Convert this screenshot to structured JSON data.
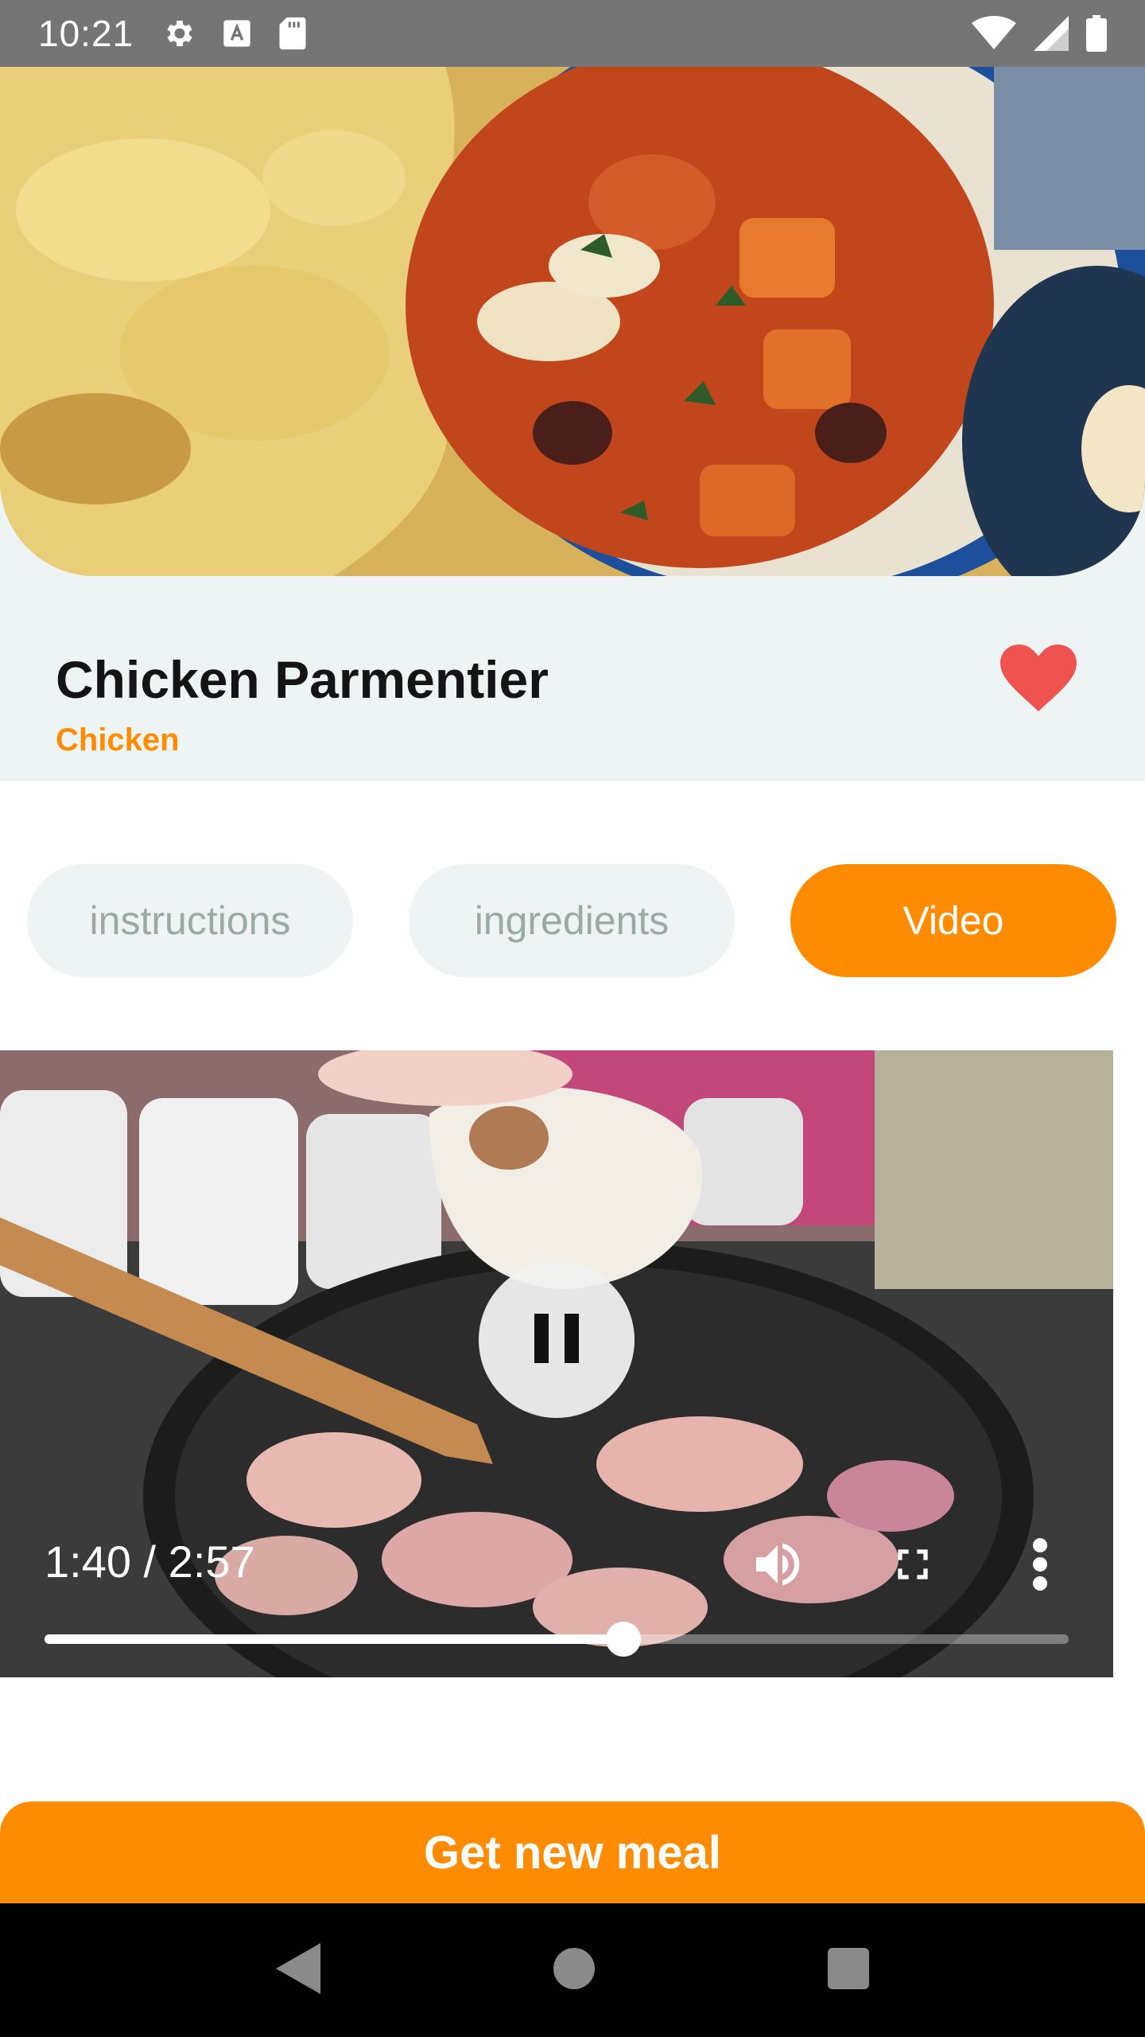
{
  "status_bar": {
    "time": "10:21",
    "icons_left": [
      "settings-icon",
      "text-icon",
      "sd-card-icon"
    ],
    "icons_right": [
      "wifi-icon",
      "signal-icon",
      "battery-icon"
    ]
  },
  "meal": {
    "title": "Chicken Parmentier",
    "category": "Chicken",
    "favorite": true
  },
  "tabs": [
    {
      "label": "instructions",
      "active": false
    },
    {
      "label": "ingredients",
      "active": false
    },
    {
      "label": "Video",
      "active": true
    }
  ],
  "video": {
    "time_display": "1:40 / 2:57",
    "progress": 0.565,
    "state": "playing",
    "controls": [
      "pause-icon",
      "volume-icon",
      "fullscreen-icon",
      "more-vert-icon"
    ]
  },
  "actions": {
    "new_meal_label": "Get new meal"
  },
  "nav": [
    "back-icon",
    "home-icon",
    "recents-icon"
  ],
  "colors": {
    "accent": "#ff8c00",
    "favorite": "#ef5350",
    "surface": "#eef3f3"
  }
}
